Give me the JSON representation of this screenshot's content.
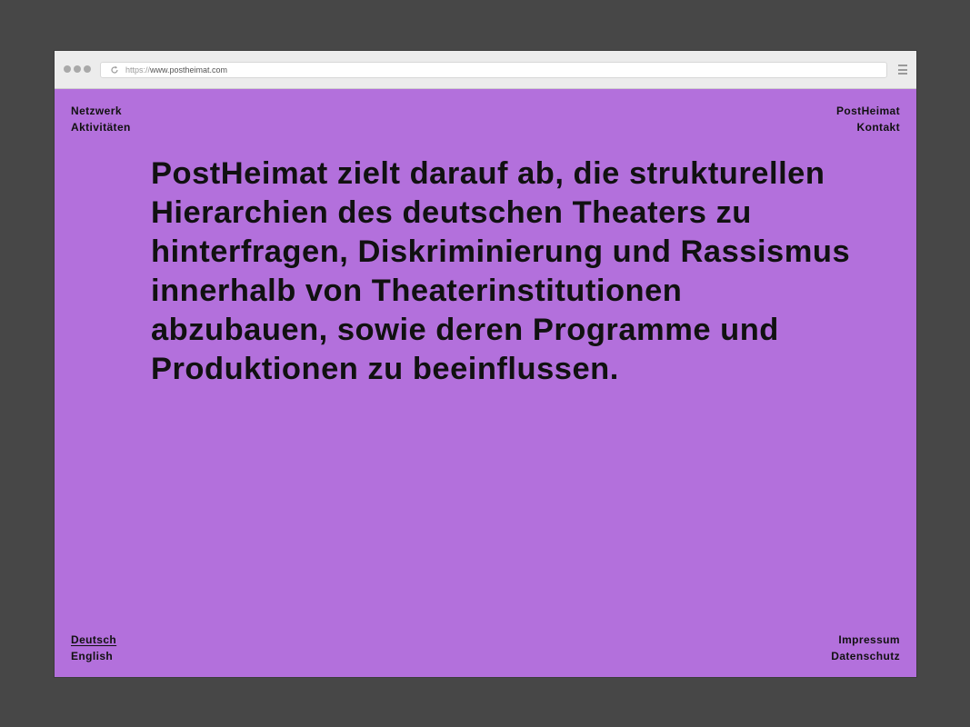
{
  "browser": {
    "url_scheme": "https://",
    "url_host": "www.postheimat.com"
  },
  "nav": {
    "top_left": [
      "Netzwerk",
      "Aktivitäten"
    ],
    "top_right": [
      "PostHeimat",
      "Kontakt"
    ],
    "languages": [
      "Deutsch",
      "English"
    ],
    "active_language": "Deutsch",
    "bottom_right": [
      "Impressum",
      "Datenschutz"
    ]
  },
  "main": {
    "statement": "PostHeimat zielt darauf ab, die strukturellen Hierarchien des deutschen Theaters zu hinterfragen, Diskriminierung und Rassismus innerhalb von Theaterinstitutionen abzubauen, sowie deren Programme und Produktionen zu beeinflussen."
  },
  "colors": {
    "background": "#b370dc",
    "text": "#111111",
    "frame": "#474747"
  },
  "icons": {
    "window_controls": "three-dots-icon",
    "reload": "reload-icon",
    "menu": "hamburger-menu-icon"
  }
}
